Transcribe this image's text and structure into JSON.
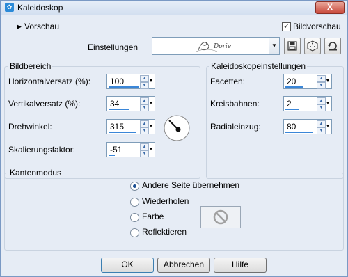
{
  "window": {
    "title": "Kaleidoskop",
    "close_symbol": "X"
  },
  "header": {
    "preview_label": "Vorschau",
    "image_preview_label": "Bildvorschau",
    "image_preview_checked": true,
    "settings_label": "Einstellungen",
    "settings_value": "Dorie"
  },
  "bildbereich": {
    "title": "Bildbereich",
    "fields": [
      {
        "label": "Horizontalversatz (%):",
        "value": "100",
        "level": 1.0
      },
      {
        "label": "Vertikalversatz (%):",
        "value": "34",
        "level": 0.67
      },
      {
        "label": "Drehwinkel:",
        "value": "315",
        "level": 0.88
      },
      {
        "label": "Skalierungsfaktor:",
        "value": "-51",
        "level": 0.2
      }
    ]
  },
  "kaleido": {
    "title": "Kaleidoskopeinstellungen",
    "fields": [
      {
        "label": "Facetten:",
        "value": "20",
        "level": 0.6
      },
      {
        "label": "Kreisbahnen:",
        "value": "2",
        "level": 0.45
      },
      {
        "label": "Radialeinzug:",
        "value": "80",
        "level": 0.9
      }
    ]
  },
  "kanten": {
    "title": "Kantenmodus",
    "options": [
      "Andere Seite übernehmen",
      "Wiederholen",
      "Farbe",
      "Reflektieren"
    ],
    "selected": "Andere Seite übernehmen"
  },
  "footer": {
    "ok": "OK",
    "cancel": "Abbrechen",
    "help": "Hilfe"
  },
  "icons": [
    "dialog-app-icon",
    "expand-arrow-icon",
    "save-preset-icon",
    "randomize-dice-icon",
    "reset-icon",
    "angle-dial-icon",
    "no-color-icon"
  ]
}
